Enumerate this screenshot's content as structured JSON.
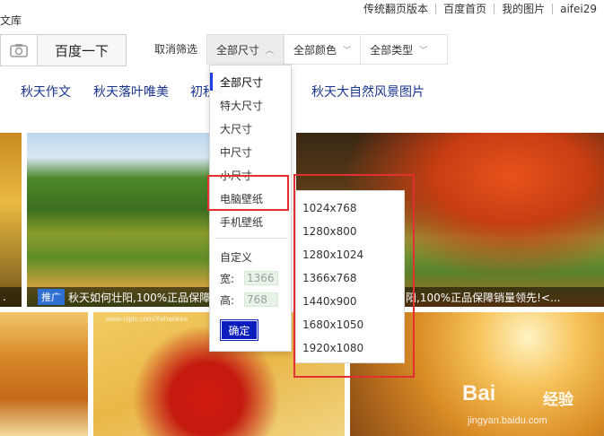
{
  "header": {
    "library_fragment": "文库",
    "links": [
      "传统翻页版本",
      "百度首页",
      "我的图片",
      "aifei29"
    ]
  },
  "search": {
    "search_button": "百度一下"
  },
  "filters": {
    "cancel_label": "取消筛选",
    "tabs": [
      {
        "label": "全部尺寸",
        "active": true
      },
      {
        "label": "全部颜色",
        "active": false
      },
      {
        "label": "全部类型",
        "active": false
      }
    ]
  },
  "related": {
    "items": [
      "秋天作文",
      "秋天落叶唯美",
      "初秋",
      "秋天大自然风景图片"
    ]
  },
  "size_dropdown": {
    "items": [
      "全部尺寸",
      "特大尺寸",
      "大尺寸",
      "中尺寸",
      "小尺寸",
      "电脑壁纸",
      "手机壁纸"
    ],
    "selected": "全部尺寸",
    "highlighted": "电脑壁纸",
    "custom_label": "自定义",
    "width_label": "宽:",
    "width_value": "1366",
    "height_label": "高:",
    "height_value": "768",
    "confirm_label": "确定"
  },
  "wallpaper_submenu": {
    "items": [
      "1024x768",
      "1280x800",
      "1280x1024",
      "1366x768",
      "1440x900",
      "1680x1050",
      "1920x1080"
    ]
  },
  "images": {
    "captions": [
      {
        "badge": "推广",
        "text": "秋天如何壮阳,100%正品保障销量领先!<..."
      },
      {
        "text": "阳,100%正品保障销量领先!<..."
      }
    ],
    "left_caption_fragment": "."
  },
  "watermark": {
    "logo": "Bai",
    "logo_suffix": "经验",
    "url": "jingyan.baidu.com",
    "tile_mark": "www.nipic.com/Xehankee"
  }
}
